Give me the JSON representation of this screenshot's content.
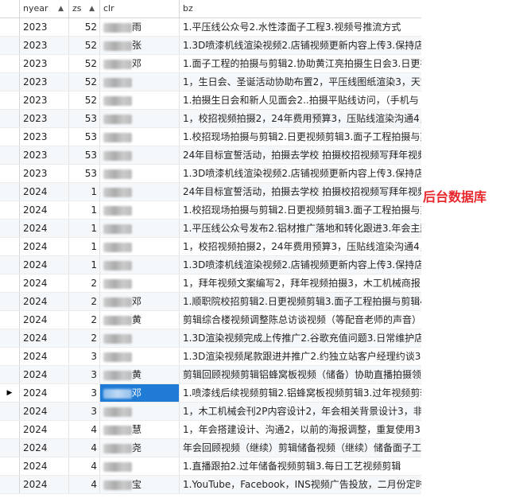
{
  "columns": [
    {
      "label": "nyear",
      "sort": "▲"
    },
    {
      "label": "zs",
      "sort": "▲"
    },
    {
      "label": "clr",
      "sort": ""
    },
    {
      "label": "bz",
      "sort": ""
    }
  ],
  "annotation": "后台数据库",
  "row_indicator": "▶",
  "rows": [
    {
      "nyear": "2023",
      "zs": "52",
      "clr": "雨",
      "bz": "1.平压线公众号2.水性漆面子工程3.视频号推流方式"
    },
    {
      "nyear": "2023",
      "zs": "52",
      "clr": "张",
      "bz": "1.3D喷漆机线渲染视频2.店铺视频更新内容上传3.保持店铺"
    },
    {
      "nyear": "2023",
      "zs": "52",
      "clr": "邓",
      "bz": "1.面子工程的拍摄与剪辑2.协助黄江亮拍摄生日会3.日更视频"
    },
    {
      "nyear": "2023",
      "zs": "52",
      "clr": "",
      "bz": "1，生日会、圣诞活动协助布置2，平压线图纸渲染3，天空"
    },
    {
      "nyear": "2023",
      "zs": "52",
      "clr": "",
      "bz": "1.拍摄生日会和新人见面会2..拍摄平贴线访问，（手机与"
    },
    {
      "nyear": "2023",
      "zs": "53",
      "clr": "",
      "bz": "1，校招视频拍摄2，24年费用预算3，压贴线渲染沟通4，"
    },
    {
      "nyear": "2023",
      "zs": "53",
      "clr": "",
      "bz": "1.校招现场拍摄与剪辑2.日更视频剪辑3.面子工程拍摄与剪"
    },
    {
      "nyear": "2023",
      "zs": "53",
      "clr": "",
      "bz": "24年目标宣誓活动，拍摄去学校 拍摄校招视频写拜年视频"
    },
    {
      "nyear": "2023",
      "zs": "53",
      "clr": "",
      "bz": "1.3D喷漆机线渲染视频2.店铺视频更新内容上传3.保持店铺"
    },
    {
      "nyear": "2024",
      "zs": "1",
      "clr": "",
      "bz": "24年目标宣誓活动，拍摄去学校 拍摄校招视频写拜年视频"
    },
    {
      "nyear": "2024",
      "zs": "1",
      "clr": "",
      "bz": "1.校招现场拍摄与剪辑2.日更视频剪辑3.面子工程拍摄与剪"
    },
    {
      "nyear": "2024",
      "zs": "1",
      "clr": "",
      "bz": "1.平压线公众号发布2.铝材推广落地和转化跟进3.年会主题"
    },
    {
      "nyear": "2024",
      "zs": "1",
      "clr": "",
      "bz": "1，校招视频拍摄2，24年费用预算3，压贴线渲染沟通4，"
    },
    {
      "nyear": "2024",
      "zs": "1",
      "clr": "",
      "bz": "1.3D喷漆机线渲染视频2.店铺视频更新内容上传3.保持店铺"
    },
    {
      "nyear": "2024",
      "zs": "2",
      "clr": "",
      "bz": "1，拜年视频文案编写2，拜年视频拍摄3，木工机械商报"
    },
    {
      "nyear": "2024",
      "zs": "2",
      "clr": "邓",
      "bz": "1.顺职院校招剪辑2.日更视频剪辑3.面子工程拍摄与剪辑4"
    },
    {
      "nyear": "2024",
      "zs": "2",
      "clr": "黄",
      "bz": "剪辑综合楼视频调整陈总访谈视频（等配音老师的声音）"
    },
    {
      "nyear": "2024",
      "zs": "2",
      "clr": "",
      "bz": "1.3D渲染视频完成上传推广2.谷歌充值问题3.日常维护店铺"
    },
    {
      "nyear": "2024",
      "zs": "3",
      "clr": "",
      "bz": "1.3D渲染视频尾款跟进并推广2.约独立站客户经理约谈3.店"
    },
    {
      "nyear": "2024",
      "zs": "3",
      "clr": "黄",
      "bz": "剪辑回顾视频剪辑铝蜂窝板视频（储备）协助直播拍摄领"
    },
    {
      "nyear": "2024",
      "zs": "3",
      "clr": "邓",
      "bz": "1.喷漆线后续视频剪辑2.铝蜂窝板视频剪辑3.过年视频剪辑"
    },
    {
      "nyear": "2024",
      "zs": "3",
      "clr": "",
      "bz": "1，木工机械会刊2P内容设计2，年会相关背景设计3，非"
    },
    {
      "nyear": "2024",
      "zs": "4",
      "clr": "慧",
      "bz": "1，年会搭建设计、沟通2，以前的海报调整，重复使用3，"
    },
    {
      "nyear": "2024",
      "zs": "4",
      "clr": "尧",
      "bz": "年会回顾视频（继续）剪辑储备视频（继续）储备面子工程"
    },
    {
      "nyear": "2024",
      "zs": "4",
      "clr": "",
      "bz": "1.直播跟拍2.过年储备视频剪辑3.每日工艺视频剪辑"
    },
    {
      "nyear": "2024",
      "zs": "4",
      "clr": "宝",
      "bz": "1.YouTube，Facebook，INS视频广告投放，二月份定时"
    }
  ]
}
